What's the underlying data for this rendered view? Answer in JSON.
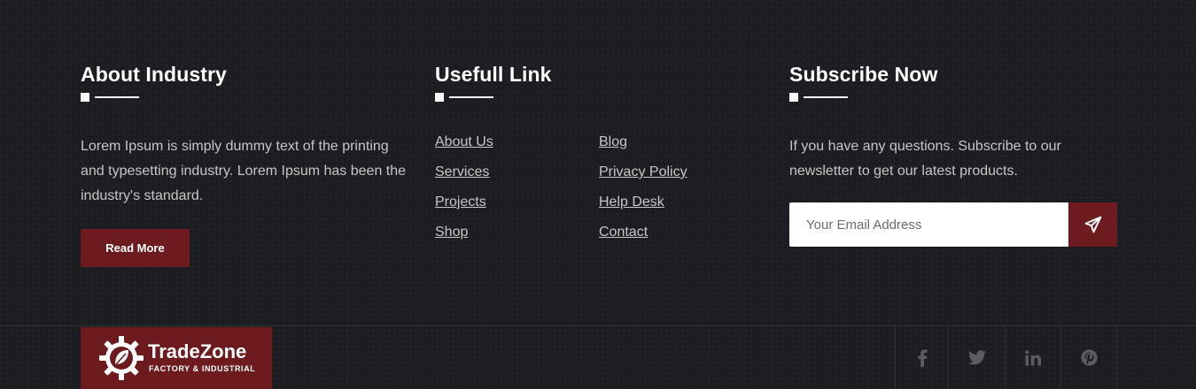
{
  "about": {
    "heading": "About Industry",
    "text": "Lorem Ipsum is simply dummy text of the printing and typesetting industry. Lorem Ipsum has been the industry's standard.",
    "button": "Read More"
  },
  "links": {
    "heading": "Usefull Link",
    "items": [
      "About Us",
      "Services",
      "Projects",
      "Shop",
      "Blog",
      "Privacy Policy",
      "Help Desk",
      "Contact"
    ]
  },
  "subscribe": {
    "heading": "Subscribe Now",
    "text": "If you have any questions. Subscribe to our newsletter to get our latest products.",
    "placeholder": "Your Email Address",
    "send_icon": "paper-plane-icon"
  },
  "brand": {
    "name": "TradeZone",
    "tagline": "FACTORY & INDUSTRIAL",
    "logo_icon": "gear-leaf-icon"
  },
  "social": {
    "icons": [
      "facebook-icon",
      "twitter-icon",
      "linkedin-icon",
      "pinterest-icon"
    ]
  },
  "colors": {
    "background": "#1b1d21",
    "accent": "#6e1b20",
    "text": "#c7c7c7"
  }
}
